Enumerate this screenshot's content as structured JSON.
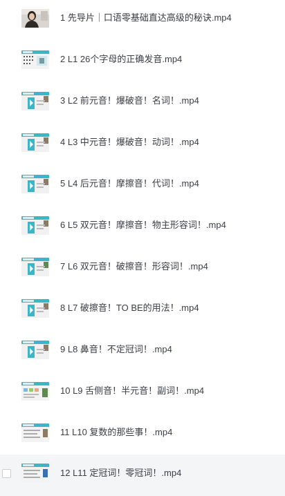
{
  "files": [
    {
      "name": "1 先导片｜口语零基础直达高级的秘诀.mp4",
      "thumbnail": "presenter-video-thumbnail"
    },
    {
      "name": "2 L1 26个字母的正确发音.mp4",
      "thumbnail": "lesson-slide-thumbnail"
    },
    {
      "name": "3 L2 前元音！爆破音！名词！.mp4",
      "thumbnail": "lesson-slide-thumbnail"
    },
    {
      "name": "4 L3 中元音！爆破音！动词！.mp4",
      "thumbnail": "lesson-slide-thumbnail"
    },
    {
      "name": "5 L4 后元音！摩擦音！代词！.mp4",
      "thumbnail": "lesson-slide-thumbnail"
    },
    {
      "name": "6 L5 双元音！摩擦音！物主形容词！.mp4",
      "thumbnail": "lesson-slide-thumbnail"
    },
    {
      "name": "7 L6 双元音！破擦音！形容词！.mp4",
      "thumbnail": "lesson-slide-thumbnail"
    },
    {
      "name": "8 L7 破擦音！TO BE的用法！.mp4",
      "thumbnail": "lesson-slide-thumbnail"
    },
    {
      "name": "9 L8 鼻音！不定冠词！.mp4",
      "thumbnail": "lesson-slide-thumbnail"
    },
    {
      "name": "10 L9 舌侧音！半元音！副词！.mp4",
      "thumbnail": "lesson-slide-thumbnail"
    },
    {
      "name": "11 L10 复数的那些事！.mp4",
      "thumbnail": "lesson-slide-thumbnail"
    },
    {
      "name": "12 L11 定冠词！零冠词！.mp4",
      "thumbnail": "lesson-slide-thumbnail"
    }
  ],
  "colors": {
    "text": "#3a3d44",
    "row_hover_bg": "#f4f5f7",
    "thumb_teal": "#3cb6c6",
    "thumb_header": "#2a9fb0"
  }
}
